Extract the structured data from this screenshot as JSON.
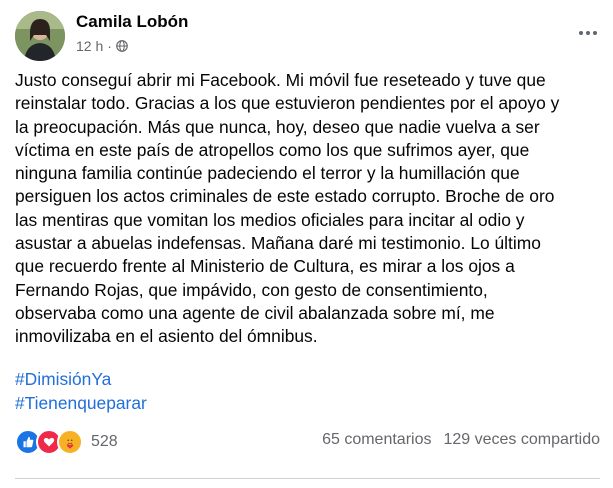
{
  "post": {
    "author": "Camila Lobón",
    "time": "12 h",
    "separator": "·",
    "privacy_icon": "globe-icon",
    "more_icon": "ellipsis-icon",
    "lines": [
      "Justo conseguí abrir mi Facebook. Mi móvil fue reseteado y tuve que",
      "reinstalar todo. Gracias a los que estuvieron pendientes por el apoyo y",
      "la preocupación. Más que nunca, hoy, deseo que nadie vuelva a ser",
      "víctima en este país de atropellos como los que sufrimos ayer, que",
      "ninguna familia continúe padeciendo el terror y la humillación que",
      "persiguen los actos criminales de este estado corrupto. Broche de oro",
      "las mentiras que vomitan los medios oficiales para incitar al odio y",
      "asustar a abuelas indefensas. Mañana daré mi testimonio. Lo último",
      "que recuerdo frente al Ministerio de Cultura, es mirar a los ojos a",
      "Fernando Rojas, que impávido, con gesto de consentimiento,",
      "observaba como una agente de civil abalanzada sobre mí, me",
      "inmovilizaba en el asiento del ómnibus."
    ],
    "hashtags": [
      "#DimisiónYa",
      "#Tienenqueparar"
    ]
  },
  "engagement": {
    "reaction_icons": [
      "like-icon",
      "love-icon",
      "care-icon"
    ],
    "reaction_count": "528",
    "comments": "65 comentarios",
    "shares": "129 veces compartido"
  },
  "colors": {
    "text": "#050505",
    "secondary": "#65676b",
    "hashtag": "#216fdb",
    "like": "#1b74e4",
    "love": "#f02849",
    "care": "#f7b125",
    "divider": "#ced0d4"
  }
}
